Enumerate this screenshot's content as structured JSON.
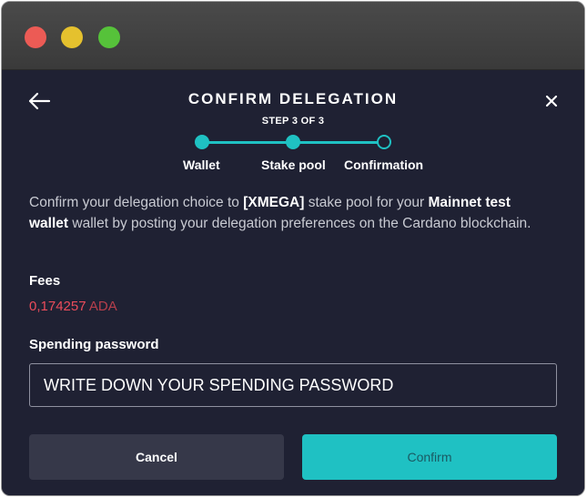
{
  "window": {
    "controls": [
      "close",
      "minimize",
      "maximize"
    ]
  },
  "dialog": {
    "title": "CONFIRM DELEGATION",
    "step_text": "STEP 3 OF 3",
    "steps": [
      {
        "label": "Wallet",
        "state": "done"
      },
      {
        "label": "Stake pool",
        "state": "done"
      },
      {
        "label": "Confirmation",
        "state": "current"
      }
    ],
    "description": {
      "part1": "Confirm your delegation choice to ",
      "pool": "[XMEGA]",
      "part2": " stake pool for your ",
      "wallet": "Mainnet test wallet",
      "part3": " wallet by posting your delegation preferences on the Cardano blockchain."
    },
    "fees_label": "Fees",
    "fees_amount": "0,174257",
    "fees_unit": "ADA",
    "password_label": "Spending password",
    "password_placeholder": "WRITE DOWN YOUR SPENDING PASSWORD",
    "cancel_label": "Cancel",
    "confirm_label": "Confirm"
  },
  "colors": {
    "background": "#1f2133",
    "accent": "#1fc1c3",
    "fees": "#ea4c5b",
    "cancel_button": "#363849"
  },
  "icons": {
    "back": "arrow-left-icon",
    "close": "close-icon"
  }
}
